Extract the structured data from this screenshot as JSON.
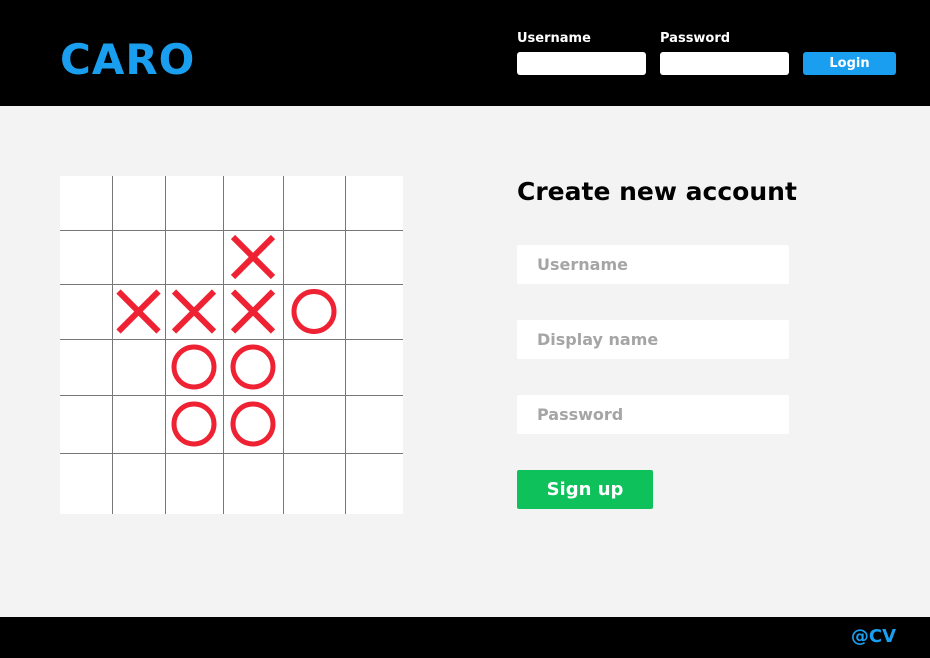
{
  "header": {
    "logo": "CARO",
    "username_label": "Username",
    "password_label": "Password",
    "username_value": "",
    "password_value": "",
    "login_label": "Login"
  },
  "board": {
    "rows": 6,
    "cols": 6,
    "marks": [
      {
        "row": 1,
        "col": 3,
        "symbol": "X"
      },
      {
        "row": 2,
        "col": 1,
        "symbol": "X"
      },
      {
        "row": 2,
        "col": 2,
        "symbol": "X"
      },
      {
        "row": 2,
        "col": 3,
        "symbol": "X"
      },
      {
        "row": 2,
        "col": 4,
        "symbol": "O"
      },
      {
        "row": 3,
        "col": 2,
        "symbol": "O"
      },
      {
        "row": 3,
        "col": 3,
        "symbol": "O"
      },
      {
        "row": 4,
        "col": 2,
        "symbol": "O"
      },
      {
        "row": 4,
        "col": 3,
        "symbol": "O"
      }
    ],
    "mark_color": "#ee2233"
  },
  "signup": {
    "title": "Create new account",
    "username_placeholder": "Username",
    "display_name_placeholder": "Display name",
    "password_placeholder": "Password",
    "submit_label": "Sign up"
  },
  "footer": {
    "credit": "@CV"
  },
  "colors": {
    "accent": "#1a9ff0",
    "success": "#0ec15a",
    "bar": "#000000",
    "background": "#f3f3f3"
  }
}
